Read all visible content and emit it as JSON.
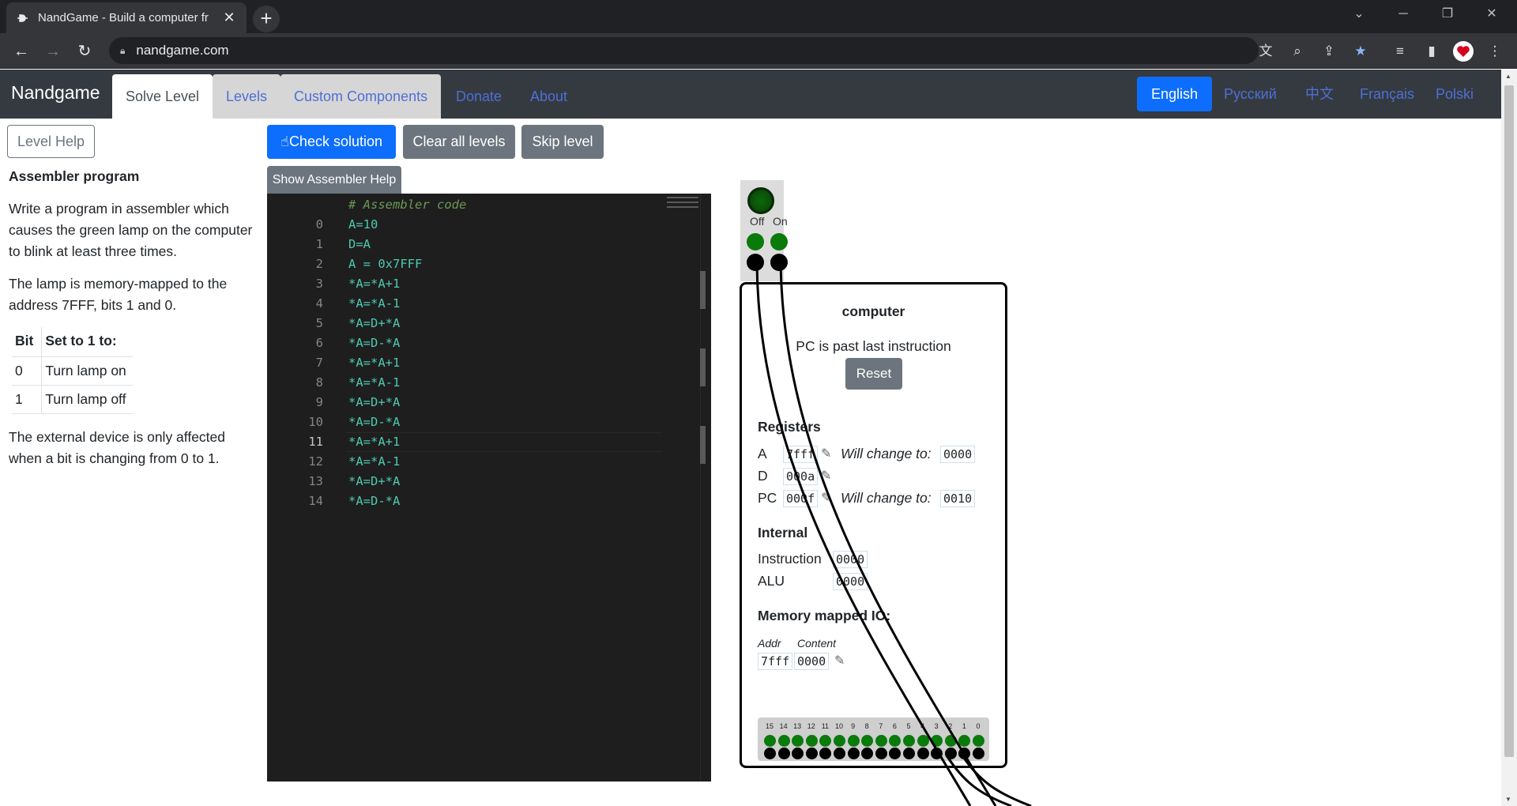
{
  "browser": {
    "tab_title": "NandGame - Build a computer fr",
    "url": "nandgame.com"
  },
  "nav": {
    "brand": "Nandgame",
    "tabs": [
      "Solve Level",
      "Levels",
      "Custom Components",
      "Donate",
      "About"
    ],
    "languages": [
      "English",
      "Русский",
      "中文",
      "Français",
      "Polski"
    ]
  },
  "left": {
    "level_help": "Level Help",
    "heading": "Assembler program",
    "para1": "Write a program in assembler which causes the green lamp on the computer to blink at least three times.",
    "para2": "The lamp is memory-mapped to the address 7FFF, bits 1 and 0.",
    "table_headers": [
      "Bit",
      "Set to 1 to:"
    ],
    "table_rows": [
      [
        "0",
        "Turn lamp on"
      ],
      [
        "1",
        "Turn lamp off"
      ]
    ],
    "para3": "The external device is only affected when a bit is changing from 0 to 1."
  },
  "buttons": {
    "check": "Check solution",
    "clear": "Clear all levels",
    "skip": "Skip level",
    "asm_help": "Show Assembler Help"
  },
  "editor": {
    "comment": "# Assembler code",
    "lines": [
      "A=10",
      "D=A",
      "A = 0x7FFF",
      "*A=*A+1",
      "*A=*A-1",
      "*A=D+*A",
      "*A=D-*A",
      "*A=*A+1",
      "*A=*A-1",
      "*A=D+*A",
      "*A=D-*A",
      "*A=*A+1",
      "*A=*A-1",
      "*A=D+*A",
      "*A=D-*A"
    ],
    "current_line": 11
  },
  "lamp": {
    "off_label": "Off",
    "on_label": "On"
  },
  "computer": {
    "title": "computer",
    "status": "PC is past last instruction",
    "reset": "Reset",
    "registers_heading": "Registers",
    "reg_a_label": "A",
    "reg_a_value": "7fff",
    "reg_a_next": "0000",
    "reg_d_label": "D",
    "reg_d_value": "000a",
    "reg_pc_label": "PC",
    "reg_pc_value": "000f",
    "reg_pc_next": "0010",
    "will_change": "Will change to:",
    "internal_heading": "Internal",
    "instruction_label": "Instruction",
    "instruction_value": "0000",
    "alu_label": "ALU",
    "alu_value": "0000",
    "mio_heading": "Memory mapped IO:",
    "addr_label": "Addr",
    "content_label": "Content",
    "mio_addr": "7fff",
    "mio_content": "0000",
    "bit_labels": [
      "15",
      "14",
      "13",
      "12",
      "11",
      "10",
      "9",
      "8",
      "7",
      "6",
      "5",
      "4",
      "3",
      "2",
      "1",
      "0"
    ]
  }
}
